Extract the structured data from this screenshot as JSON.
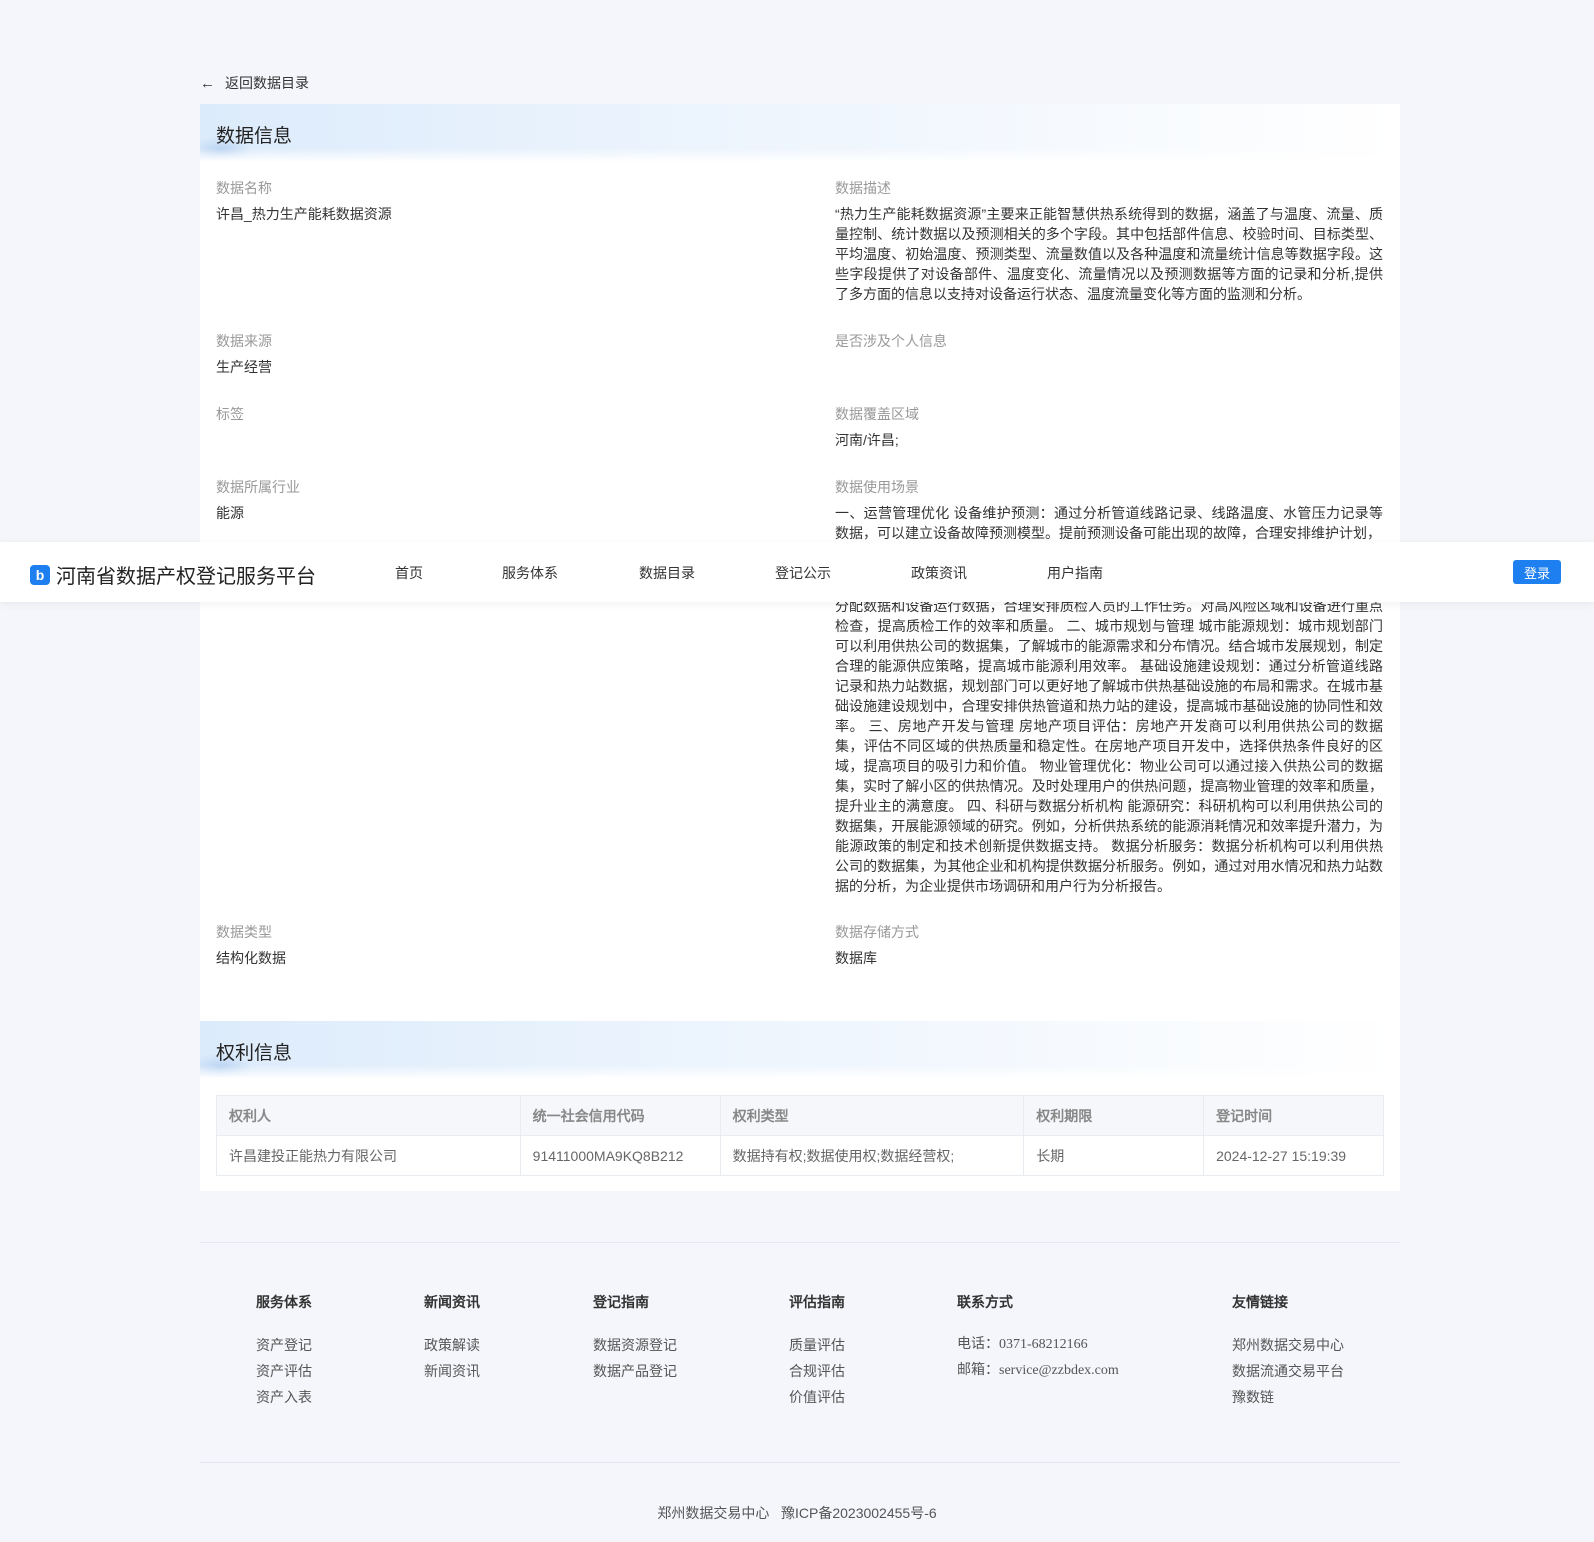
{
  "back_link": {
    "label": "返回数据目录"
  },
  "data_info": {
    "title": "数据信息",
    "fields": {
      "name": {
        "label": "数据名称",
        "value": "许昌_热力生产能耗数据资源"
      },
      "description": {
        "label": "数据描述",
        "value": "“热力生产能耗数据资源”主要来正能智慧供热系统得到的数据，涵盖了与温度、流量、质量控制、统计数据以及预测相关的多个字段。其中包括部件信息、校验时间、目标类型、平均温度、初始温度、预测类型、流量数值以及各种温度和流量统计信息等数据字段。这些字段提供了对设备部件、温度变化、流量情况以及预测数据等方面的记录和分析,提供了多方面的信息以支持对设备运行状态、温度流量变化等方面的监测和分析。"
      },
      "source": {
        "label": "数据来源",
        "value": "生产经营"
      },
      "personal_info": {
        "label": "是否涉及个人信息",
        "value": ""
      },
      "tags": {
        "label": "标签",
        "value": ""
      },
      "coverage": {
        "label": "数据覆盖区域",
        "value": "河南/许昌;"
      },
      "industry": {
        "label": "数据所属行业",
        "value": "能源"
      },
      "scenario": {
        "label": "数据使用场景",
        "value_top": "一、运营管理优化 设备维护预测：通过分析管道线路记录、线路温度、水管压力记录等数据，可以建立设备故障预测模型。提前预测设备可能出现的故障，合理安排维护计划，",
        "value_bottom": "分配数据和设备运行数据，合理安排质检人员的工作任务。对高风险区域和设备进行重点检查，提高质检工作的效率和质量。 二、城市规划与管理 城市能源规划：城市规划部门可以利用供热公司的数据集，了解城市的能源需求和分布情况。结合城市发展规划，制定合理的能源供应策略，提高城市能源利用效率。 基础设施建设规划：通过分析管道线路记录和热力站数据，规划部门可以更好地了解城市供热基础设施的布局和需求。在城市基础设施建设规划中，合理安排供热管道和热力站的建设，提高城市基础设施的协同性和效率。 三、房地产开发与管理 房地产项目评估：房地产开发商可以利用供热公司的数据集，评估不同区域的供热质量和稳定性。在房地产项目开发中，选择供热条件良好的区域，提高项目的吸引力和价值。 物业管理优化：物业公司可以通过接入供热公司的数据集，实时了解小区的供热情况。及时处理用户的供热问题，提高物业管理的效率和质量，提升业主的满意度。 四、科研与数据分析机构 能源研究：科研机构可以利用供热公司的数据集，开展能源领域的研究。例如，分析供热系统的能源消耗情况和效率提升潜力，为能源政策的制定和技术创新提供数据支持。 数据分析服务：数据分析机构可以利用供热公司的数据集，为其他企业和机构提供数据分析服务。例如，通过对用水情况和热力站数据的分析，为企业提供市场调研和用户行为分析报告。"
      },
      "data_type": {
        "label": "数据类型",
        "value": "结构化数据"
      },
      "storage": {
        "label": "数据存储方式",
        "value": "数据库"
      }
    }
  },
  "navbar": {
    "logo_text": "河南省数据产权登记服务平台",
    "logo_mark": "b",
    "items": [
      "首页",
      "服务体系",
      "数据目录",
      "登记公示",
      "政策资讯",
      "用户指南"
    ],
    "login_label": "登录",
    "accent_color": "#1e7ff0"
  },
  "rights_info": {
    "title": "权利信息",
    "columns": [
      "权利人",
      "统一社会信用代码",
      "权利类型",
      "权利期限",
      "登记时间"
    ],
    "rows": [
      [
        "许昌建投正能热力有限公司",
        "91411000MA9KQ8B212",
        "数据持有权;数据使用权;数据经营权;",
        "长期",
        "2024-12-27 15:19:39"
      ]
    ]
  },
  "footer": {
    "columns": [
      {
        "heading": "服务体系",
        "items": [
          "资产登记",
          "资产评估",
          "资产入表"
        ]
      },
      {
        "heading": "新闻资讯",
        "items": [
          "政策解读",
          "新闻资讯"
        ]
      },
      {
        "heading": "登记指南",
        "items": [
          "数据资源登记",
          "数据产品登记"
        ]
      },
      {
        "heading": "评估指南",
        "items": [
          "质量评估",
          "合规评估",
          "价值评估"
        ]
      },
      {
        "heading": "联系方式",
        "items": [
          "电话：0371-68212166",
          "邮箱：service@zzbdex.com"
        ]
      },
      {
        "heading": "友情链接",
        "items": [
          "郑州数据交易中心",
          "数据流通交易平台",
          "豫数链"
        ]
      }
    ],
    "copyright": "郑州数据交易中心   豫ICP备2023002455号-6"
  }
}
